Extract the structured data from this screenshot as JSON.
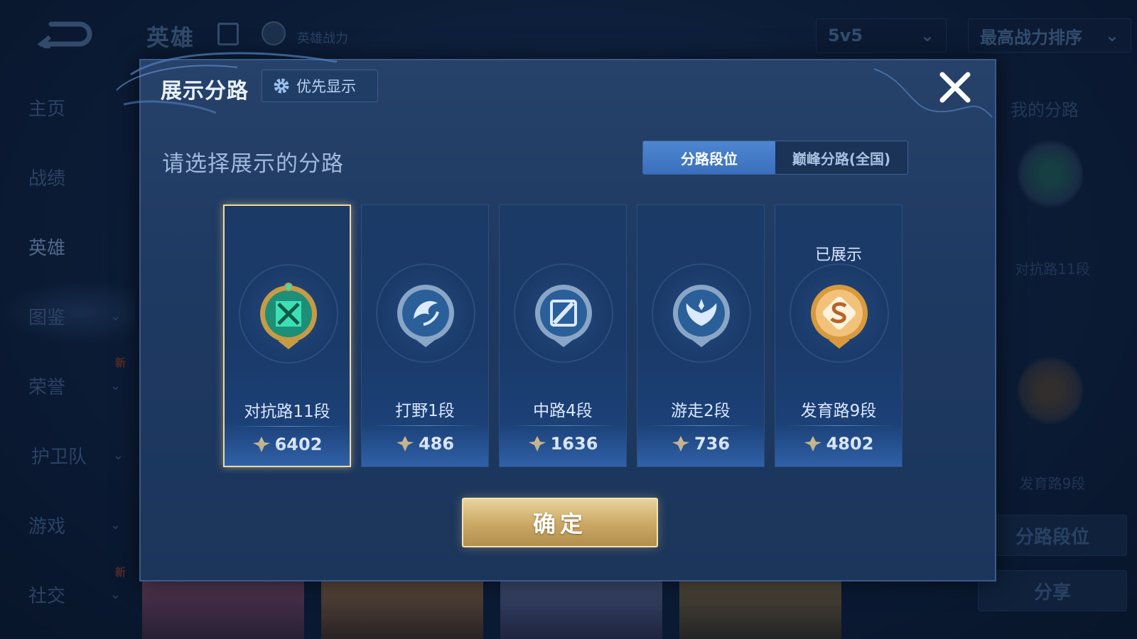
{
  "background": {
    "top_title": "英雄",
    "top_power_label": "英雄战力",
    "mode_select": "5v5",
    "sort_select": "最高战力排序",
    "sidebar": [
      {
        "label": "主页",
        "has_chevron": false
      },
      {
        "label": "战绩",
        "has_chevron": false
      },
      {
        "label": "英雄",
        "has_chevron": false,
        "active": true
      },
      {
        "label": "图鉴",
        "has_chevron": true
      },
      {
        "label": "荣誉",
        "has_chevron": true,
        "badge": "新"
      },
      {
        "label": "护卫队",
        "has_chevron": true
      },
      {
        "label": "游戏",
        "has_chevron": true
      },
      {
        "label": "社交",
        "has_chevron": true,
        "badge": "新"
      }
    ],
    "right_panel": {
      "title": "我的分路",
      "lanes": [
        "对抗路11段",
        "发育路9段"
      ],
      "rank_button": "分路段位",
      "share_button": "分享"
    }
  },
  "modal": {
    "title": "展示分路",
    "priority_button": "优先显示",
    "prompt": "请选择展示的分路",
    "tabs": [
      {
        "label": "分路段位",
        "selected": true
      },
      {
        "label": "巅峰分路(全国)",
        "selected": false
      }
    ],
    "lanes": [
      {
        "name": "对抗路11段",
        "score": "6402",
        "emblem": "top-lane-emblem",
        "color": "#2ec4a0",
        "selected": true,
        "shown_label": ""
      },
      {
        "name": "打野1段",
        "score": "486",
        "emblem": "jungle-emblem",
        "color": "#7fb0e0",
        "selected": false,
        "shown_label": ""
      },
      {
        "name": "中路4段",
        "score": "1636",
        "emblem": "mid-lane-emblem",
        "color": "#8fb8e6",
        "selected": false,
        "shown_label": ""
      },
      {
        "name": "游走2段",
        "score": "736",
        "emblem": "support-emblem",
        "color": "#8fb8e6",
        "selected": false,
        "shown_label": ""
      },
      {
        "name": "发育路9段",
        "score": "4802",
        "emblem": "bot-lane-emblem",
        "color": "#e0a24a",
        "selected": false,
        "shown_label": "已展示"
      }
    ],
    "confirm_button": "确定"
  },
  "colors": {
    "accent_gold": "#f2d89c",
    "tab_active": "#3a6fbd",
    "modal_bg": "#1f3a62"
  }
}
